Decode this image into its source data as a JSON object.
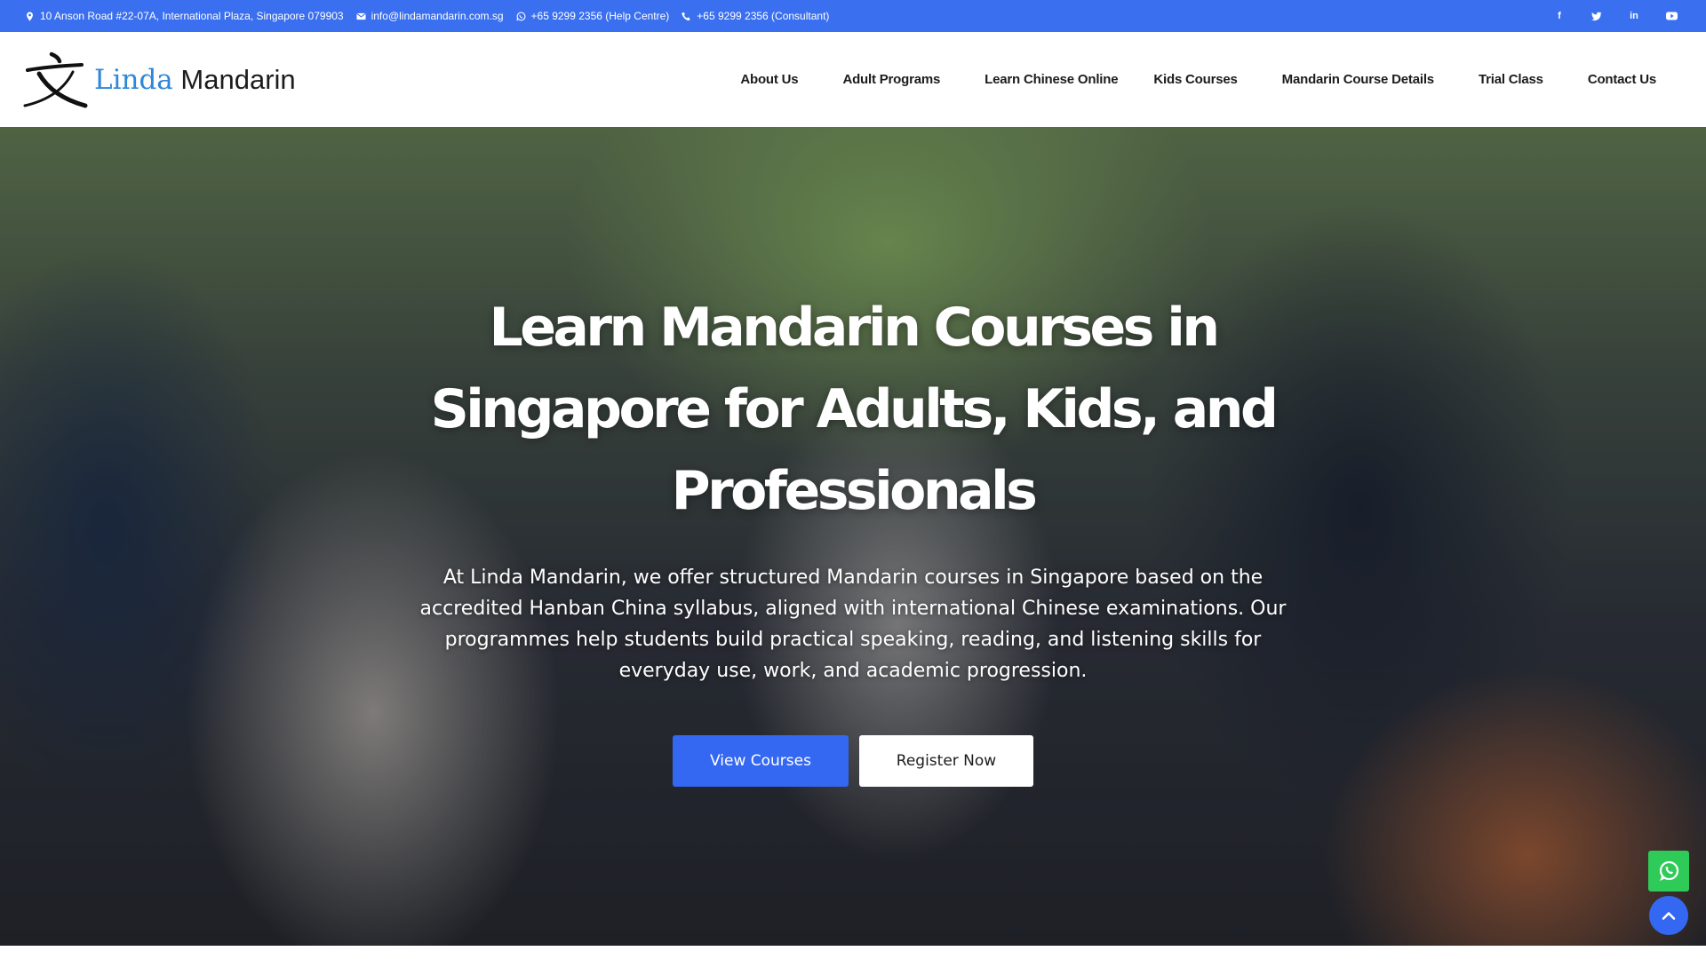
{
  "topbar": {
    "address": "10 Anson Road #22-07A, International Plaza, Singapore 079903",
    "email": "info@lindamandarin.com.sg",
    "whatsapp": "+65 9299 2356 (Help Centre)",
    "phone": "+65 9299 2356 (Consultant)",
    "social": {
      "facebook": "f",
      "twitter": "twitter-icon",
      "linkedin": "in",
      "youtube": "youtube-icon"
    },
    "bg_color": "#3a6ff0"
  },
  "header": {
    "logo": {
      "part1": "Linda",
      "part2": "Mandarin",
      "icon": "chinese-character-wen-logo"
    },
    "nav": [
      "About Us",
      "Adult Programs",
      "Learn Chinese Online",
      "Kids Courses",
      "Mandarin Course Details",
      "Trial Class",
      "Contact Us"
    ]
  },
  "hero": {
    "title": "Learn Mandarin Courses in Singapore for Adults, Kids, and Professionals",
    "text": "At Linda Mandarin, we offer structured Mandarin courses in Singapore based on the accredited Hanban China syllabus, aligned with international Chinese examinations. Our programmes help students build practical speaking, reading, and listening skills for everyday use, work, and academic progression.",
    "buttons": {
      "primary": "View Courses",
      "secondary": "Register Now"
    },
    "background": "classroom-photo-adult-students"
  },
  "floating": {
    "whatsapp_icon": "whatsapp-icon",
    "back_to_top_icon": "chevron-up-icon",
    "whatsapp_color": "#2fcb59",
    "accent_color": "#3468f2"
  }
}
